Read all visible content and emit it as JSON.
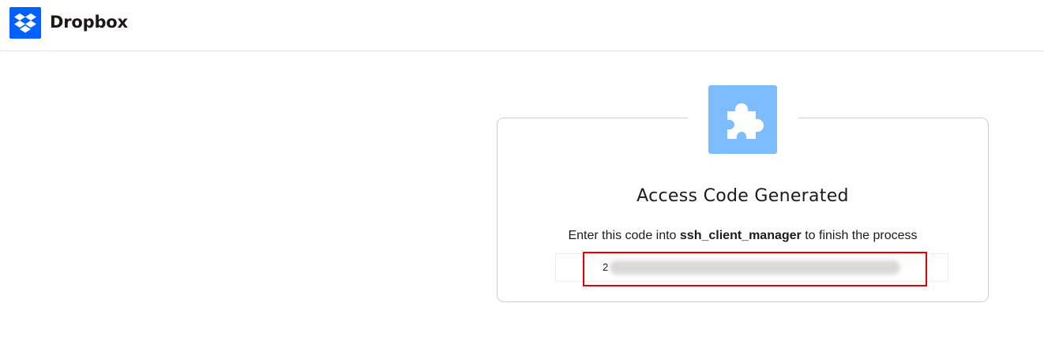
{
  "header": {
    "brand_name": "Dropbox",
    "logo_icon": "dropbox-logo-icon",
    "brand_color": "#0061fe"
  },
  "card": {
    "app_icon": "puzzle-piece-icon",
    "app_icon_color": "#7cbcff",
    "title": "Access Code Generated",
    "instruction_prefix": "Enter this code into ",
    "app_name": "ssh_client_manager",
    "instruction_suffix": " to finish the process",
    "code_visible_prefix": "2",
    "highlight_color": "#e50000"
  }
}
